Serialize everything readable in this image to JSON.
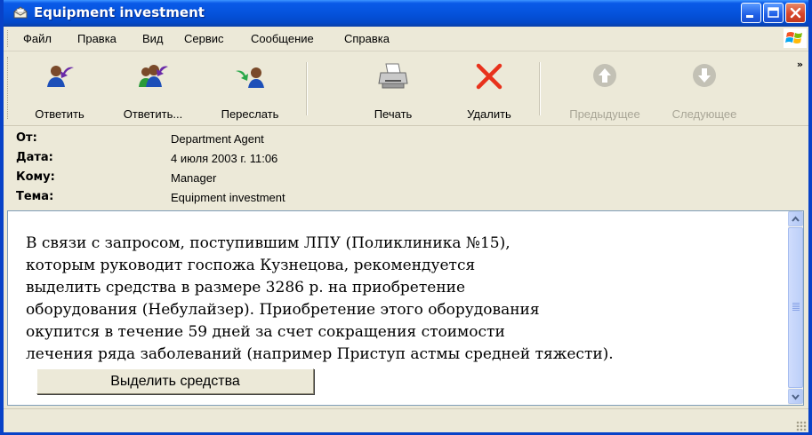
{
  "window": {
    "title": "Equipment investment",
    "icon": "envelope-icon",
    "controls": [
      "minimize-icon",
      "maximize-icon",
      "close-icon"
    ]
  },
  "menu": {
    "items": [
      "Файл",
      "Правка",
      "Вид",
      "Сервис",
      "Сообщение",
      "Справка"
    ]
  },
  "toolbar": {
    "buttons": [
      {
        "label": "Ответить",
        "icon": "reply-icon",
        "enabled": true
      },
      {
        "label": "Ответить...",
        "icon": "reply-all-icon",
        "enabled": true
      },
      {
        "label": "Переслать",
        "icon": "forward-icon",
        "enabled": true
      },
      {
        "label": "Печать",
        "icon": "printer-icon",
        "enabled": true
      },
      {
        "label": "Удалить",
        "icon": "delete-icon",
        "enabled": true
      },
      {
        "label": "Предыдущее",
        "icon": "up-arrow-icon",
        "enabled": false
      },
      {
        "label": "Следующее",
        "icon": "down-arrow-icon",
        "enabled": false
      }
    ],
    "overflow": "»"
  },
  "headers": [
    {
      "label": "От:",
      "value": "Department Agent"
    },
    {
      "label": "Дата:",
      "value": "4 июля 2003 г. 11:06"
    },
    {
      "label": "Кому:",
      "value": "Manager"
    },
    {
      "label": "Тема:",
      "value": "Equipment investment"
    }
  ],
  "message": {
    "lines": [
      "В связи с запросом, поступившим ЛПУ (Поликлиника №15),",
      "которым руководит госпожа Кузнецова, рекомендуется",
      "выделить средства в размере 3286 р. на приобретение",
      "оборудования (Небулайзер). Приобретение этого оборудования",
      "окупится в течение 59 дней за счет сокращения стоимости",
      "лечения ряда заболеваний (например Приступ астмы средней тяжести)."
    ],
    "action_button": "Выделить средства"
  },
  "colors": {
    "titlebar": "#0553dc",
    "chrome": "#ece9d8",
    "delete_x": "#e8321c"
  }
}
